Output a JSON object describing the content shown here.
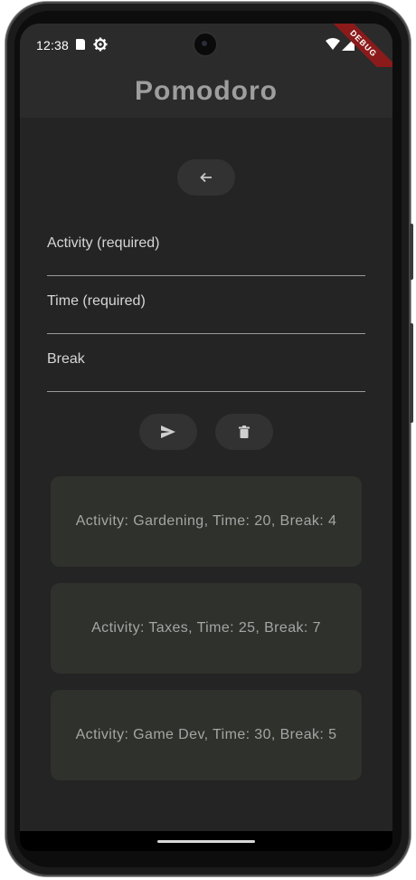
{
  "status_bar": {
    "time": "12:38",
    "icons": [
      "sd-card-icon",
      "gear-icon",
      "wifi-icon",
      "signal-icon"
    ]
  },
  "debug_banner": "DEBUG",
  "app_bar": {
    "title": "Pomodoro"
  },
  "back_button": {
    "icon": "arrow-left-icon"
  },
  "form": {
    "activity_placeholder": "Activity (required)",
    "time_placeholder": "Time (required)",
    "break_placeholder": "Break"
  },
  "actions": {
    "send_icon": "send-icon",
    "delete_icon": "trash-icon"
  },
  "sessions": [
    "Activity: Gardening, Time: 20, Break: 4",
    "Activity: Taxes, Time: 25, Break: 7",
    "Activity: Game Dev, Time: 30, Break: 5"
  ],
  "colors": {
    "background": "#242424",
    "app_bar": "#2b2b2b",
    "title": "#9e9e9e",
    "card": "#2f312c",
    "button": "#323232"
  }
}
